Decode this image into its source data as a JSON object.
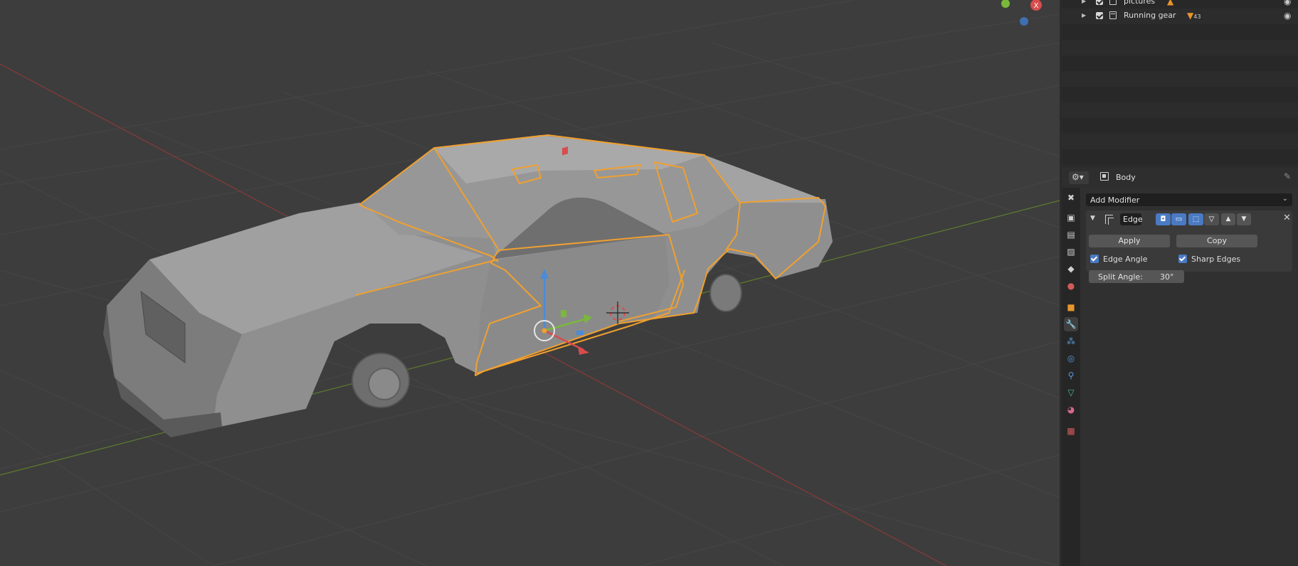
{
  "outliner": {
    "rows": [
      {
        "name": "pictures",
        "badge": "",
        "badge_count": ""
      },
      {
        "name": "Running gear",
        "badge": "▼",
        "badge_count": "43"
      }
    ]
  },
  "properties": {
    "object_name": "Body",
    "add_modifier_label": "Add Modifier",
    "modifier": {
      "name": "Edge",
      "apply_label": "Apply",
      "copy_label": "Copy",
      "edge_angle_label": "Edge Angle",
      "edge_angle_checked": true,
      "sharp_edges_label": "Sharp Edges",
      "sharp_edges_checked": true,
      "split_angle_label": "Split Angle:",
      "split_angle_value": "30°"
    }
  },
  "gizmo": {
    "x_label": "X"
  },
  "colors": {
    "selection_outline": "#f0a030",
    "x_axis": "#b84a4a",
    "y_axis": "#7aa83a",
    "active_blue": "#4a7ac4",
    "viewport_bg": "#3d3d3d"
  }
}
